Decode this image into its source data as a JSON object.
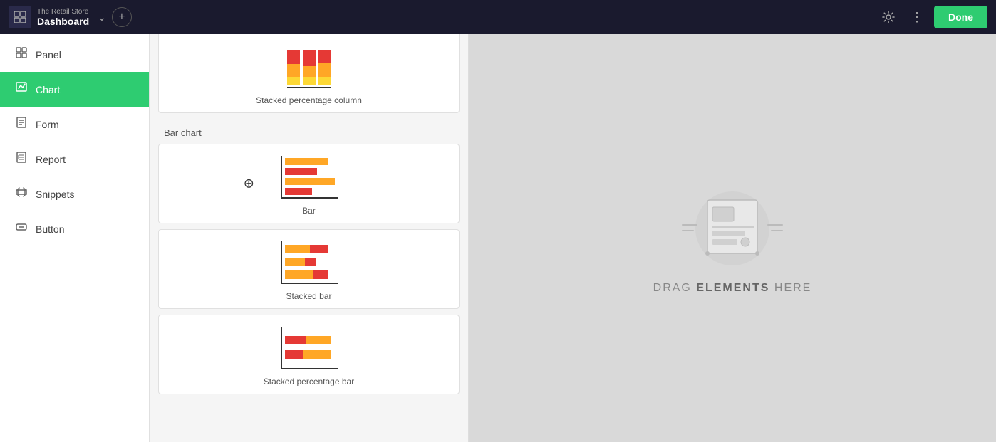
{
  "topbar": {
    "app_subtitle": "The Retail Store",
    "app_title": "Dashboard",
    "done_label": "Done"
  },
  "sidebar": {
    "items": [
      {
        "id": "panel",
        "label": "Panel",
        "icon": "⊞"
      },
      {
        "id": "chart",
        "label": "Chart",
        "icon": "📊",
        "active": true
      },
      {
        "id": "form",
        "label": "Form",
        "icon": "📋"
      },
      {
        "id": "report",
        "label": "Report",
        "icon": "🗒"
      },
      {
        "id": "snippets",
        "label": "Snippets",
        "icon": "✂"
      },
      {
        "id": "button",
        "label": "Button",
        "icon": "▣"
      }
    ]
  },
  "chart_panel": {
    "sections": [
      {
        "id": "column",
        "label": "",
        "items": [
          {
            "id": "stacked-pct-col",
            "label": "Stacked percentage column"
          }
        ]
      },
      {
        "id": "bar",
        "label": "Bar chart",
        "items": [
          {
            "id": "bar",
            "label": "Bar"
          },
          {
            "id": "stacked-bar",
            "label": "Stacked bar"
          },
          {
            "id": "stacked-pct-bar",
            "label": "Stacked percentage bar"
          }
        ]
      }
    ]
  },
  "drop_zone": {
    "drag_text_prefix": "DRAG ",
    "drag_text_bold": "ELEMENTS",
    "drag_text_suffix": " HERE"
  },
  "colors": {
    "red": "#e53935",
    "orange": "#ffa726",
    "yellow": "#fdd835",
    "active_green": "#2ecc71",
    "topbar_bg": "#1a1a2e"
  }
}
